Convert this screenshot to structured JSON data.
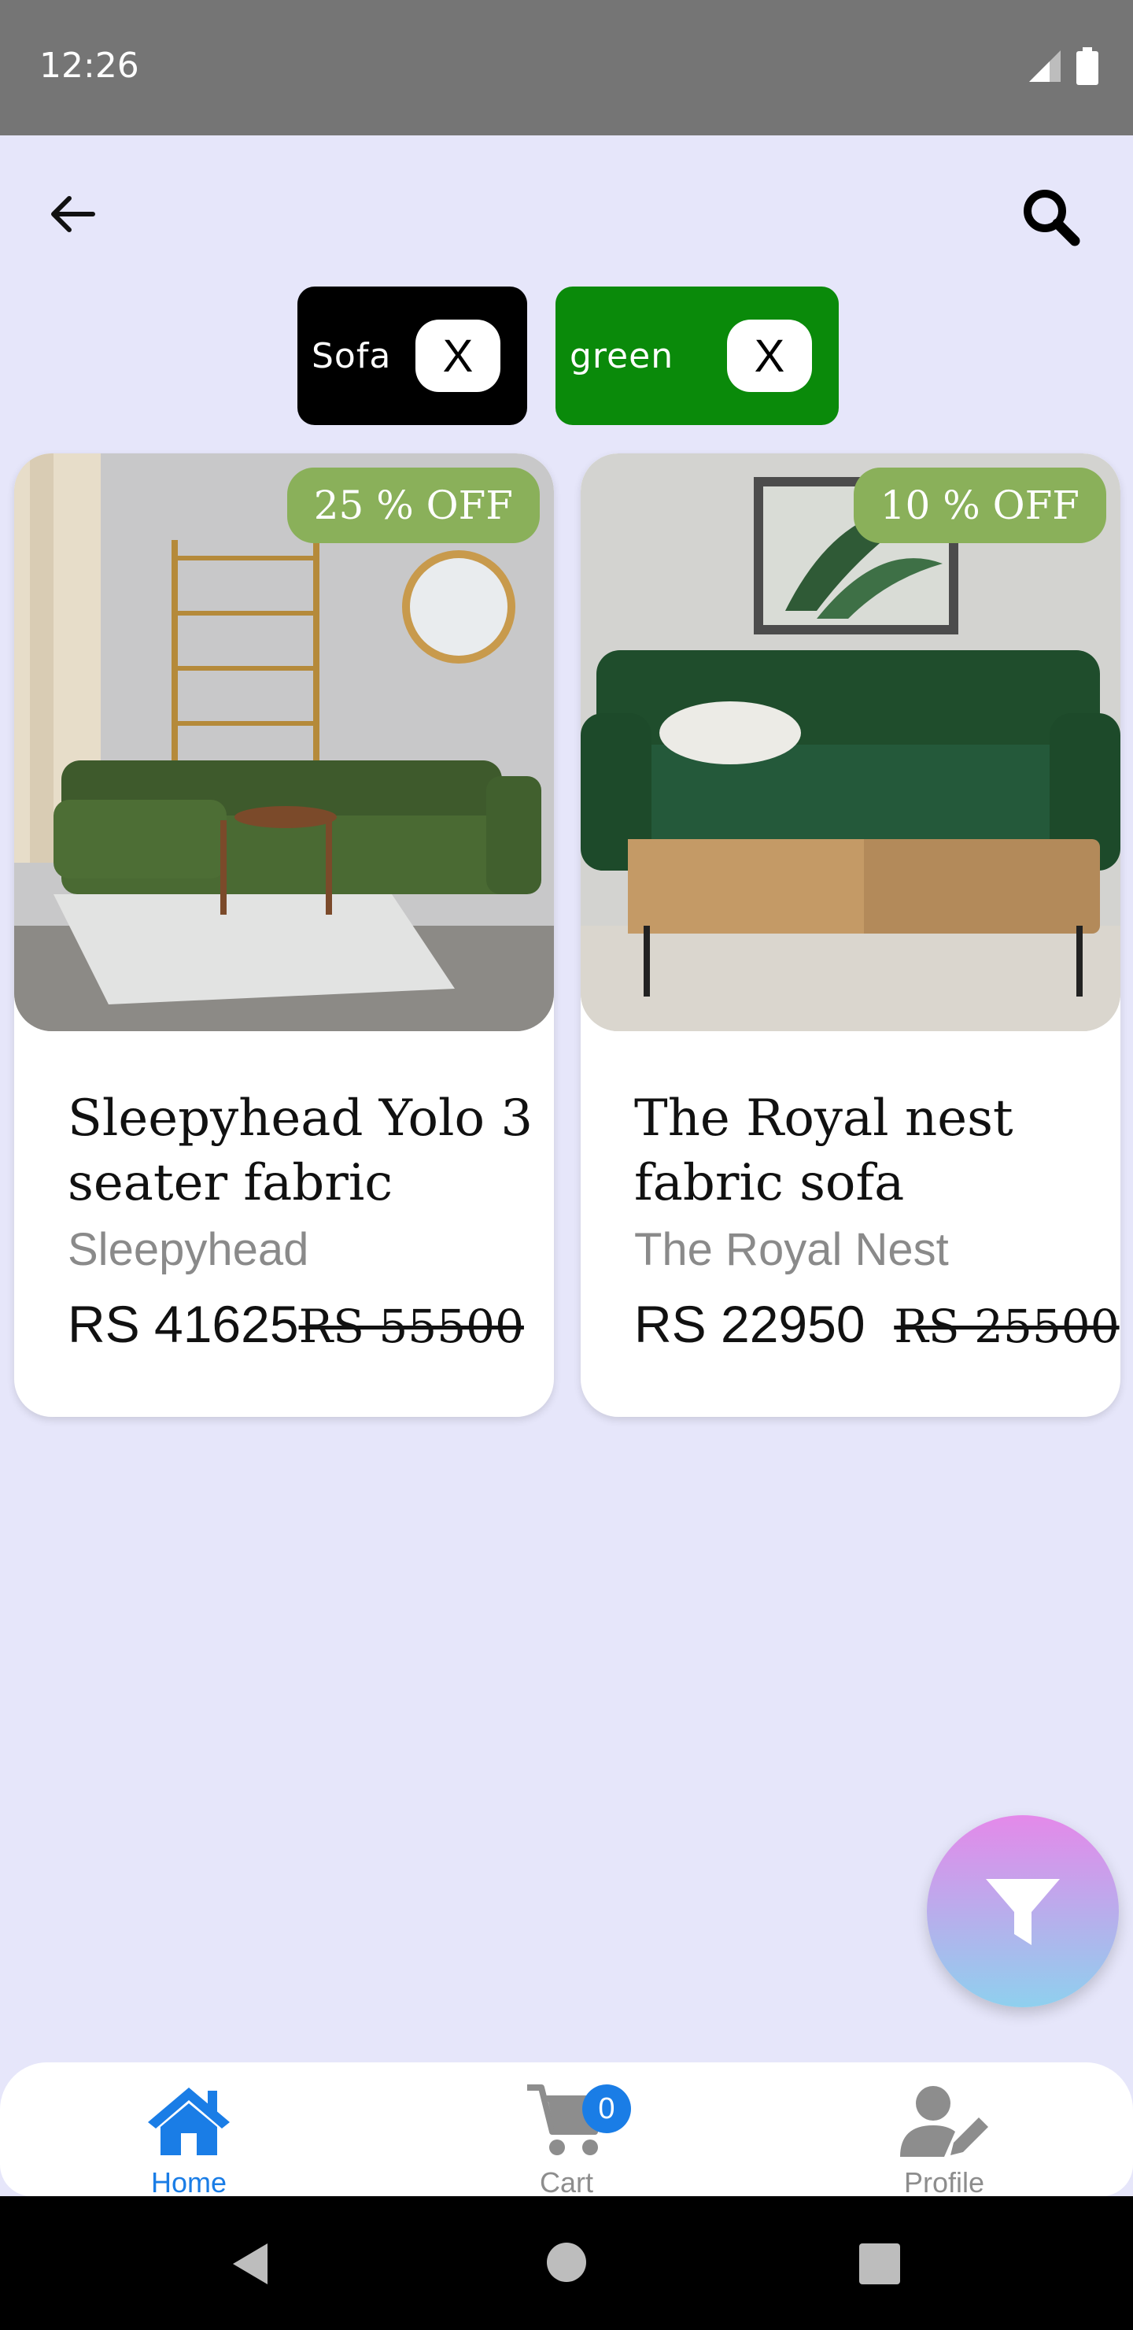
{
  "status_bar": {
    "time": "12:26"
  },
  "filters": [
    {
      "label": "Sofa",
      "remove": "X",
      "color": "#000000"
    },
    {
      "label": "green",
      "remove": "X",
      "color": "#0a8a0a"
    }
  ],
  "products": [
    {
      "discount": "25 % OFF",
      "title": "Sleepyhead Yolo 3 seater fabric",
      "brand": "Sleepyhead",
      "price": "RS 41625",
      "old_price": "RS 55500"
    },
    {
      "discount": "10 % OFF",
      "title": "The Royal nest fabric sofa",
      "brand": "The Royal Nest",
      "price": "RS 22950",
      "old_price": "RS 25500"
    }
  ],
  "bottom_nav": {
    "home": "Home",
    "cart": "Cart",
    "cart_count": "0",
    "profile": "Profile"
  },
  "colors": {
    "background": "#e6e6fa",
    "accent": "#1a7de6",
    "discount": "#8ab05a"
  }
}
